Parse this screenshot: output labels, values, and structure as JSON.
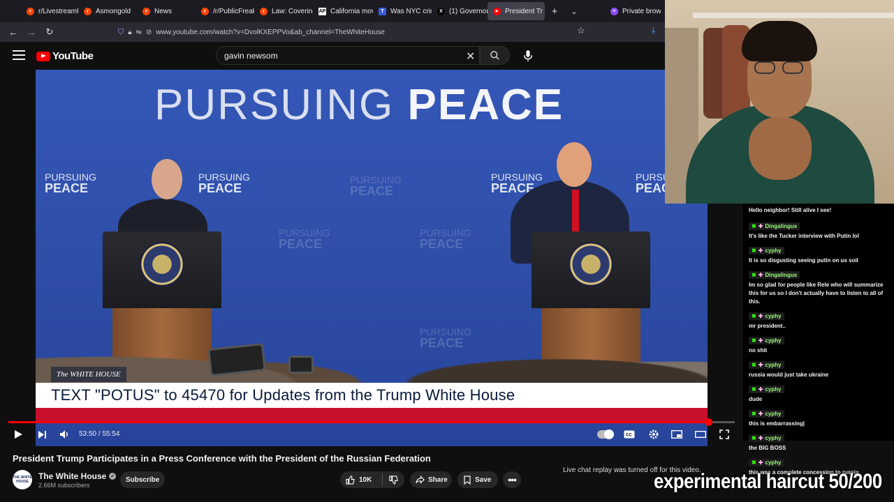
{
  "browser": {
    "tabs": [
      {
        "label": "r/LivestreamFa",
        "color": "#ff4500",
        "glyph": "r"
      },
      {
        "label": "Asmongold",
        "color": "#ff4500",
        "glyph": "r"
      },
      {
        "label": "News",
        "color": "#ff4500",
        "glyph": "r"
      },
      {
        "label": "/r/PublicFreak",
        "color": "#ff4500",
        "glyph": "r"
      },
      {
        "label": "Law: Covering",
        "color": "#ff4500",
        "glyph": "r"
      },
      {
        "label": "California mov",
        "color": "#ffffff",
        "glyph": "AP"
      },
      {
        "label": "Was NYC crim",
        "color": "#3b5bdb",
        "glyph": "T"
      },
      {
        "label": "(1) Governor N",
        "color": "#000000",
        "glyph": "X"
      },
      {
        "label": "President Tr",
        "color": "#ff0000",
        "glyph": "▶",
        "active": true
      }
    ],
    "private_tab": "Private browsin",
    "url": "www.youtube.com/watch?v=DvolKXEPPVo&ab_channel=TheWhiteHouse"
  },
  "youtube": {
    "logo_text": "YouTube",
    "search_value": "gavin newsom"
  },
  "video": {
    "headline_light": "PURSUING ",
    "headline_bold": "PEACE",
    "watermark_top": "PURSUING",
    "watermark_bottom": "PEACE",
    "network_tag": "The WHITE HOUSE",
    "lower_third": "TEXT \"POTUS\" to 45470 for Updates from the Trump White House",
    "time": "53:50 / 55:54",
    "progress": 0.963
  },
  "meta": {
    "title": "President Trump Participates in a Press Conference with the President of the Russian Federation",
    "channel": "The White House",
    "avatar_text": "THE WHITE HOUSE",
    "subscribers": "2.66M subscribers",
    "subscribe": "Subscribe",
    "likes": "10K",
    "share": "Share",
    "save": "Save",
    "chat_off": "Live chat replay was turned off for this video."
  },
  "chat": {
    "first_line": "Hello neighbor! Still alive I see!",
    "messages": [
      {
        "user": "Dingalingus",
        "text": "It's like the Tucker interview with Putin lol"
      },
      {
        "user": "cyphy",
        "text": "It is so disgusting seeing putin on us soil"
      },
      {
        "user": "Dingalingus",
        "text": "Im so glad for people like Rele who will summarize this for us so I don't actually have to listen to all of this."
      },
      {
        "user": "cyphy",
        "text": "mr president.."
      },
      {
        "user": "cyphy",
        "text": "no shit"
      },
      {
        "user": "cyphy",
        "text": "russia would just take ukraine"
      },
      {
        "user": "cyphy",
        "text": "dude"
      },
      {
        "user": "cyphy",
        "text": "this is embarrassing|"
      },
      {
        "user": "cyphy",
        "text": "the BIG BOSS"
      },
      {
        "user": "cyphy",
        "text": "this was a complete concession to russia"
      }
    ]
  },
  "stream_overlay": "experimental haircut 50/200"
}
